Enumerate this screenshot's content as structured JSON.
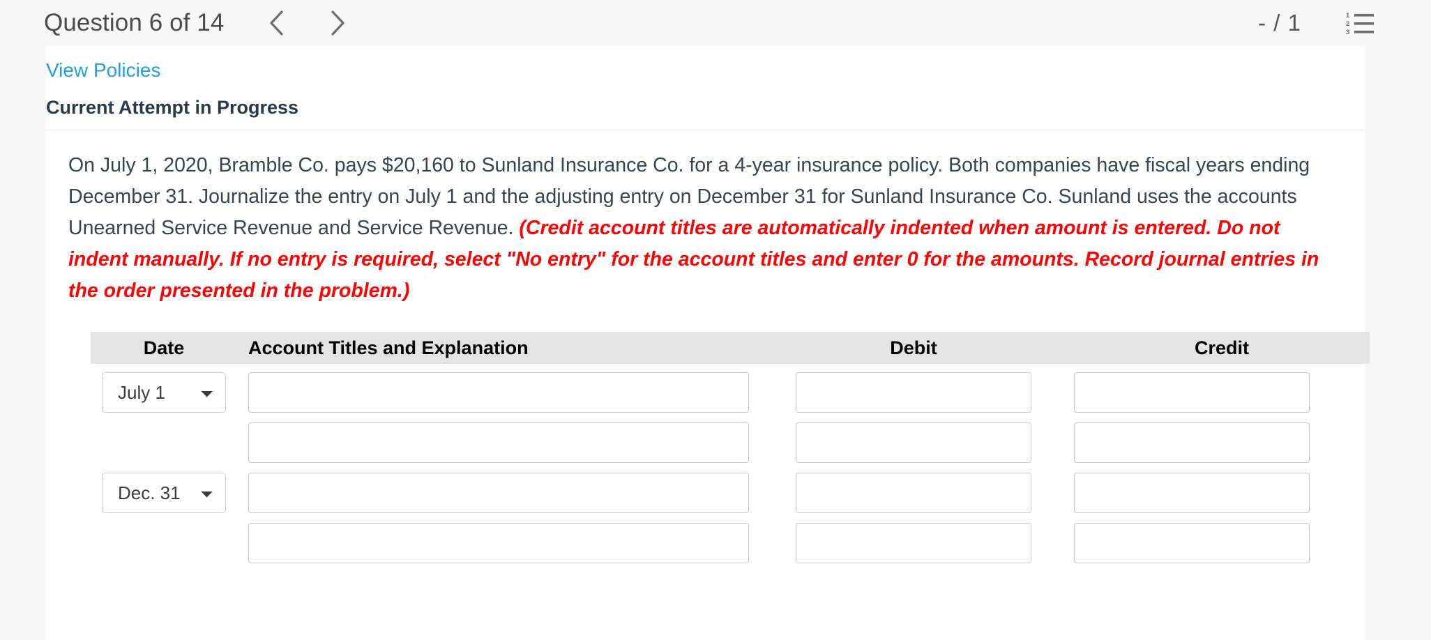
{
  "header": {
    "question_label": "Question 6 of 14",
    "prev_icon": "chevron-left-icon",
    "next_icon": "chevron-right-icon",
    "score": "- / 1",
    "list_icon": "numbered-list-icon"
  },
  "card": {
    "view_policies": "View Policies",
    "attempt_status": "Current Attempt in Progress",
    "question_main": "On July 1, 2020, Bramble Co. pays $20,160 to Sunland Insurance Co. for a 4-year insurance policy. Both companies have fiscal years ending December 31. Journalize the entry on July 1 and the adjusting entry on December 31 for Sunland Insurance Co. Sunland uses the accounts Unearned Service Revenue and Service Revenue. ",
    "question_instruction": "(Credit account titles are automatically indented when amount is entered. Do not indent manually. If no entry is required, select \"No entry\" for the account titles and enter 0 for the amounts. Record journal entries in the order presented in the problem.)"
  },
  "journal": {
    "columns": {
      "date": "Date",
      "account": "Account Titles and Explanation",
      "debit": "Debit",
      "credit": "Credit"
    },
    "rows": [
      {
        "date_value": "July 1",
        "date_options": [
          "July 1",
          "Dec. 31"
        ],
        "has_date": true,
        "account": "",
        "debit": "",
        "credit": ""
      },
      {
        "date_value": "",
        "date_options": [],
        "has_date": false,
        "account": "",
        "debit": "",
        "credit": ""
      },
      {
        "date_value": "Dec. 31",
        "date_options": [
          "July 1",
          "Dec. 31"
        ],
        "has_date": true,
        "account": "",
        "debit": "",
        "credit": ""
      },
      {
        "date_value": "",
        "date_options": [],
        "has_date": false,
        "account": "",
        "debit": "",
        "credit": ""
      }
    ]
  },
  "colors": {
    "link": "#1f9fe8",
    "instruction_red": "#fa0505",
    "header_row_bg": "#e4e4e4",
    "page_bg": "#f7f7f7"
  }
}
